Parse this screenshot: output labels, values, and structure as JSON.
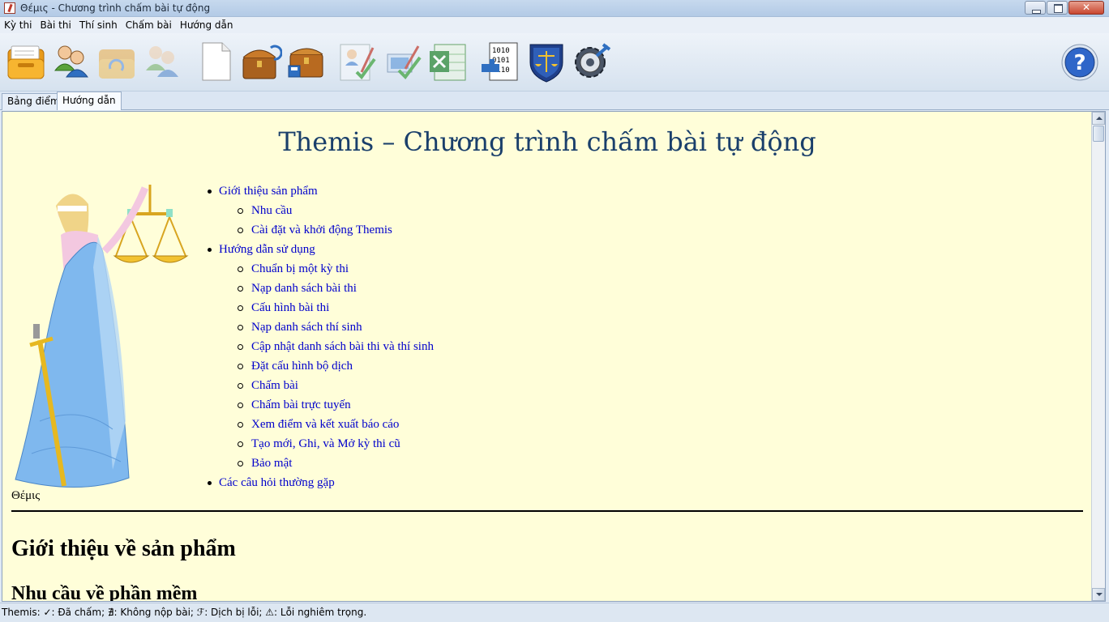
{
  "window": {
    "title": "Θέμις - Chương trình chấm bài tự động"
  },
  "menu": {
    "items": [
      "Kỳ thi",
      "Bài thi",
      "Thí sinh",
      "Chấm bài",
      "Hướng dẫn"
    ]
  },
  "toolbar": {
    "buttons": [
      {
        "name": "open-contest",
        "icon": "folder-icon"
      },
      {
        "name": "contestants",
        "icon": "users-icon"
      },
      {
        "name": "refresh-contest",
        "icon": "folder-sync-icon"
      },
      {
        "name": "sync-contestants",
        "icon": "users-sync-icon"
      },
      {
        "name": "new-document",
        "icon": "blank-document-icon"
      },
      {
        "name": "open-archive",
        "icon": "treasure-chest-icon"
      },
      {
        "name": "save-archive",
        "icon": "chest-save-icon"
      },
      {
        "name": "grade-student",
        "icon": "grade-person-icon"
      },
      {
        "name": "grade-all",
        "icon": "grade-all-icon"
      },
      {
        "name": "export-excel",
        "icon": "excel-icon"
      },
      {
        "name": "binary-config",
        "icon": "binary-icon"
      },
      {
        "name": "security",
        "icon": "justice-shield-icon"
      },
      {
        "name": "settings",
        "icon": "gear-wrench-icon"
      }
    ],
    "help_icon": "help-icon"
  },
  "tabs": {
    "score_table": "Bảng điểm",
    "guide": "Hướng dẫn",
    "active": "guide"
  },
  "content": {
    "title": "Themis – Chương trình chấm bài tự động",
    "figure_caption": "Θέμις",
    "toc": {
      "intro": {
        "label": "Giới thiệu sản phẩm",
        "children": [
          "Nhu cầu",
          "Cài đặt và khởi động Themis"
        ]
      },
      "usage": {
        "label": "Hướng dẫn sử dụng",
        "children": [
          "Chuẩn bị một kỳ thi",
          "Nạp danh sách bài thi",
          "Cấu hình bài thi",
          "Nạp danh sách thí sinh",
          "Cập nhật danh sách bài thi và thí sinh",
          "Đặt cấu hình bộ dịch",
          "Chấm bài",
          "Chấm bài trực tuyến",
          "Xem điểm và kết xuất báo cáo",
          "Tạo mới, Ghi, và Mở kỳ thi cũ",
          "Bảo mật"
        ]
      },
      "faq": {
        "label": "Các câu hỏi thường gặp"
      }
    },
    "heading_intro": "Giới thiệu về sản phẩm",
    "heading_needs": "Nhu cầu về phần mềm"
  },
  "status": {
    "text": "Themis: ✓: Đã chấm; ∄: Không nộp bài; ℱ: Dịch bị lỗi; ⚠: Lỗi nghiêm trọng."
  },
  "colors": {
    "content_bg": "#fffed9",
    "title": "#1a3f6b",
    "link": "#0000cc"
  }
}
